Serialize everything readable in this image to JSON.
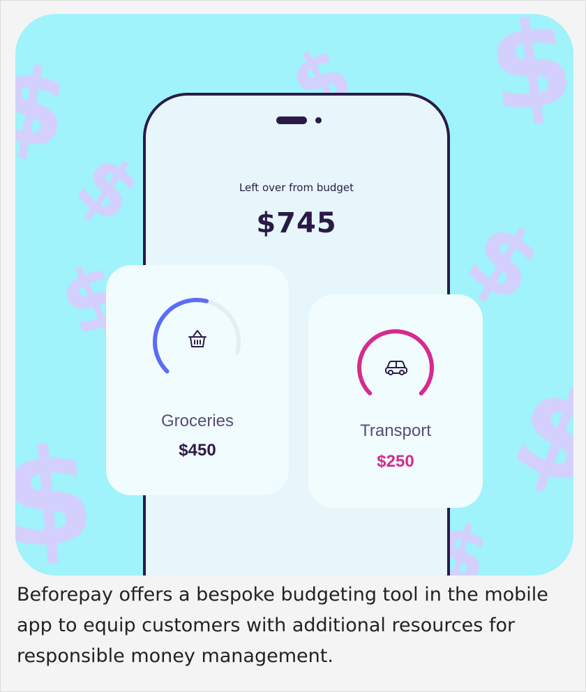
{
  "phone": {
    "budget_label": "Left over from budget",
    "budget_amount": "$745"
  },
  "cards": {
    "groceries": {
      "label": "Groceries",
      "value": "$450",
      "icon": "basket-icon",
      "gauge_fill": 0.55,
      "color": "#5b6cf6"
    },
    "transport": {
      "label": "Transport",
      "value": "$250",
      "icon": "car-icon",
      "gauge_fill": 1.0,
      "color": "#d62a8f"
    }
  },
  "caption": "Beforepay offers a bespoke budgeting tool in the mobile app to equip customers with additional resources for responsible money management.",
  "colors": {
    "background": "#a0f2fb",
    "dollar_signs": "#d4d0fd",
    "phone_outline": "#2b1a46",
    "groceries_value": "#2b1a46",
    "transport_value": "#d62a8f"
  }
}
